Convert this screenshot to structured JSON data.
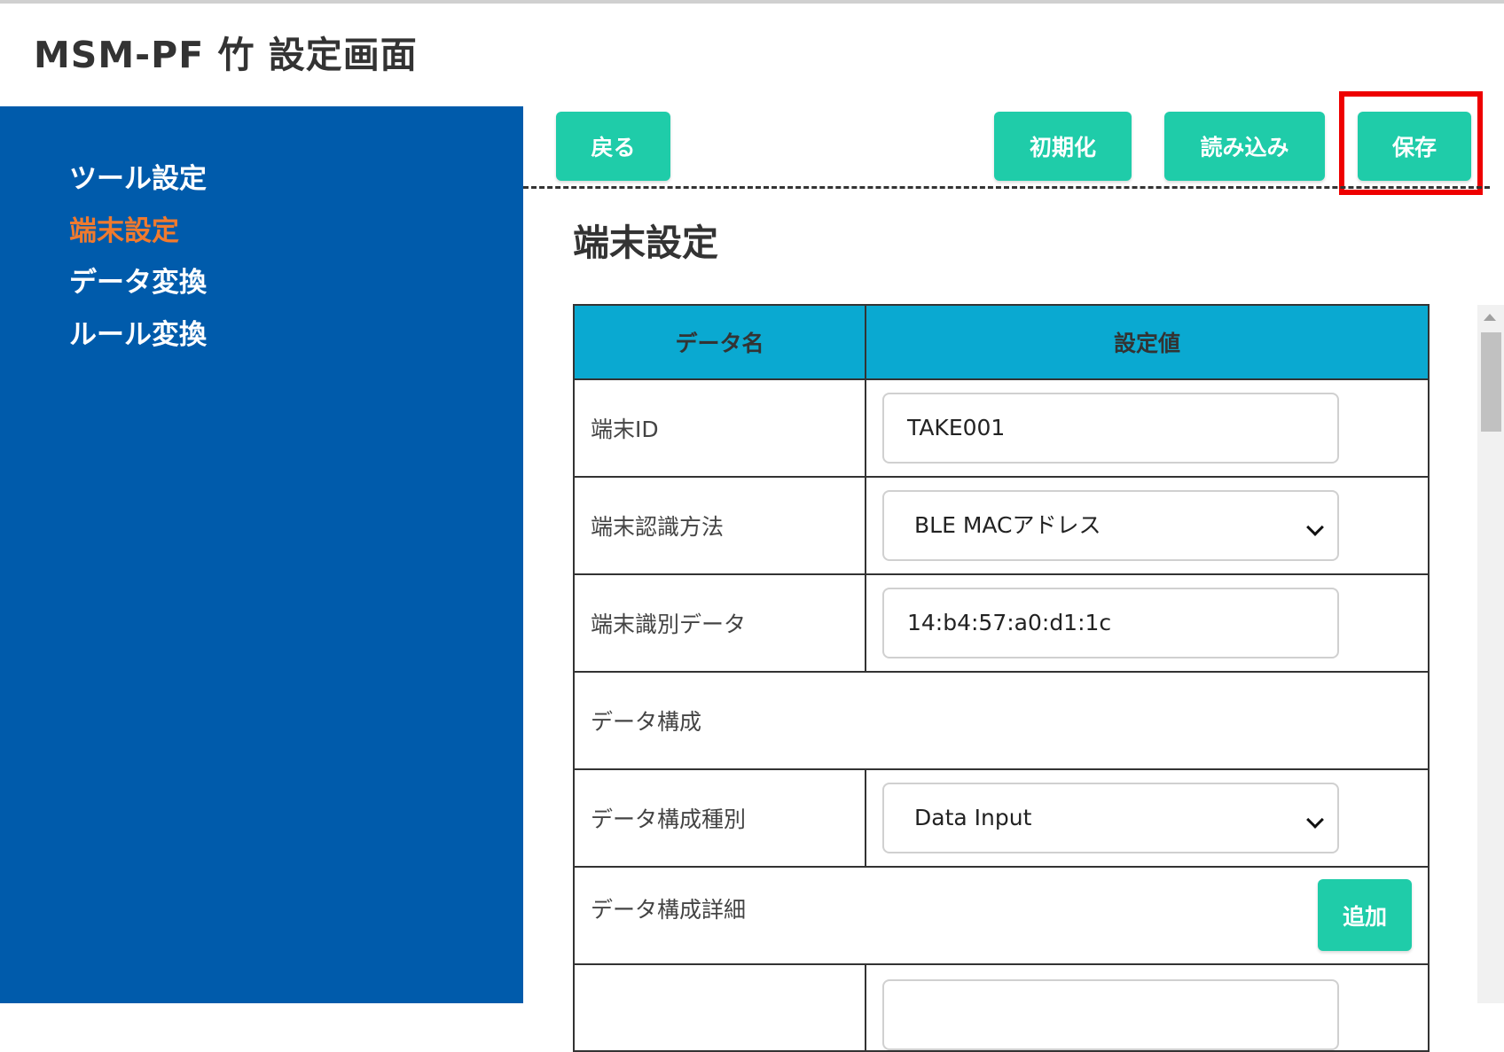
{
  "app": {
    "title": "MSM-PF 竹 設定画面"
  },
  "sidebar": {
    "items": [
      {
        "label": "ツール設定"
      },
      {
        "label": "端末設定",
        "active": true
      },
      {
        "label": "データ変換"
      },
      {
        "label": "ルール変換"
      }
    ]
  },
  "toolbar": {
    "back_label": "戻る",
    "init_label": "初期化",
    "load_label": "読み込み",
    "save_label": "保存"
  },
  "section": {
    "title": "端末設定"
  },
  "table": {
    "headers": {
      "name": "データ名",
      "value": "設定値"
    },
    "rows": {
      "terminal_id": {
        "label": "端末ID",
        "value": "TAKE001"
      },
      "recognition_method": {
        "label": "端末認識方法",
        "value": "BLE MACアドレス"
      },
      "identification_data": {
        "label": "端末識別データ",
        "value": "14:b4:57:a0:d1:1c"
      },
      "data_config": {
        "label": "データ構成"
      },
      "data_config_type": {
        "label": "データ構成種別",
        "value": "Data Input"
      },
      "data_config_detail": {
        "label": "データ構成詳細",
        "add_label": "追加"
      }
    }
  },
  "colors": {
    "sidebar_bg": "#005bab",
    "active_nav": "#f07a2e",
    "button": "#1fcca9",
    "table_header": "#0aa9d1",
    "highlight": "#ee0000"
  }
}
